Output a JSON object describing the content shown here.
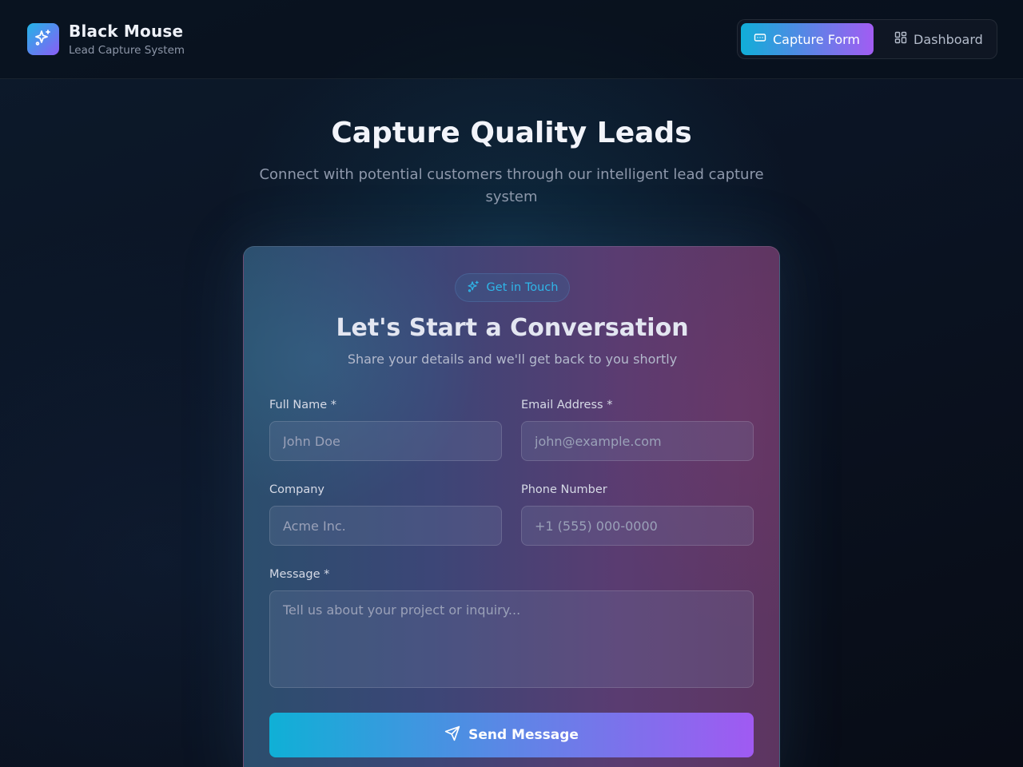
{
  "brand": {
    "title": "Black Mouse",
    "subtitle": "Lead Capture System",
    "logo_icon": "sparkles-icon",
    "colors": {
      "accent_start": "#10aed8",
      "accent_end": "#a25cf3"
    }
  },
  "nav": {
    "items": [
      {
        "label": "Capture Form",
        "icon": "form-icon",
        "active": true
      },
      {
        "label": "Dashboard",
        "icon": "grid-icon",
        "active": false
      }
    ]
  },
  "hero": {
    "title": "Capture Quality Leads",
    "subtitle": "Connect with potential customers through our intelligent lead capture system"
  },
  "form": {
    "badge": "Get in Touch",
    "badge_icon": "sparkles-icon",
    "title": "Let's Start a Conversation",
    "subtitle": "Share your details and we'll get back to you shortly",
    "fields": {
      "full_name": {
        "label": "Full Name *",
        "placeholder": "John Doe",
        "value": ""
      },
      "email": {
        "label": "Email Address *",
        "placeholder": "john@example.com",
        "value": ""
      },
      "company": {
        "label": "Company",
        "placeholder": "Acme Inc.",
        "value": ""
      },
      "phone": {
        "label": "Phone Number",
        "placeholder": "+1 (555) 000-0000",
        "value": ""
      },
      "message": {
        "label": "Message *",
        "placeholder": "Tell us about your project or inquiry...",
        "value": ""
      }
    },
    "submit_label": "Send Message",
    "submit_icon": "send-icon"
  }
}
